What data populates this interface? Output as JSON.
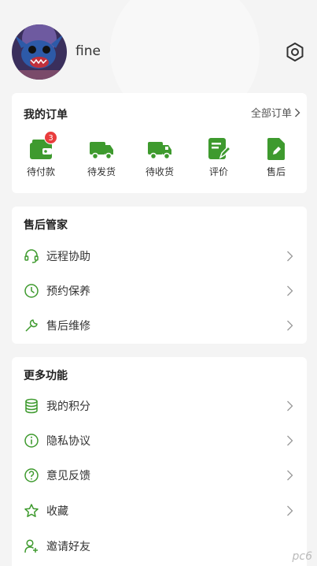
{
  "profile": {
    "username": "fine"
  },
  "orders": {
    "title": "我的订单",
    "all_label": "全部订单",
    "items": [
      {
        "label": "待付款",
        "badge": "3"
      },
      {
        "label": "待发货"
      },
      {
        "label": "待收货"
      },
      {
        "label": "评价"
      },
      {
        "label": "售后"
      }
    ]
  },
  "after_sales": {
    "title": "售后管家",
    "items": [
      {
        "label": "远程协助",
        "icon": "headset-icon"
      },
      {
        "label": "预约保养",
        "icon": "clock-icon"
      },
      {
        "label": "售后维修",
        "icon": "wrench-icon"
      }
    ]
  },
  "more": {
    "title": "更多功能",
    "items": [
      {
        "label": "我的积分",
        "icon": "coins-icon"
      },
      {
        "label": "隐私协议",
        "icon": "info-icon"
      },
      {
        "label": "意见反馈",
        "icon": "question-icon"
      },
      {
        "label": "收藏",
        "icon": "star-icon"
      },
      {
        "label": "邀请好友",
        "icon": "add-user-icon"
      }
    ]
  },
  "watermark": "pc6",
  "colors": {
    "accent": "#3e9a2e",
    "badge": "#e93d3d"
  }
}
